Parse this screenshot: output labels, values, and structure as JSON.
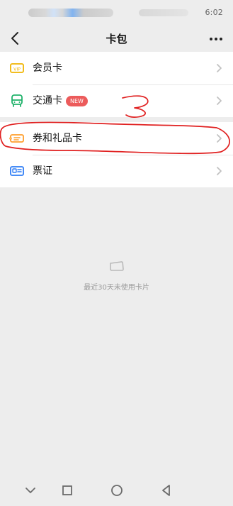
{
  "status_bar": {
    "time": "6:02"
  },
  "header": {
    "title": "卡包"
  },
  "menu": {
    "items": [
      {
        "label": "会员卡",
        "icon": "vip-icon"
      },
      {
        "label": "交通卡",
        "badge": "NEW",
        "icon": "bus-icon"
      },
      {
        "label": "券和礼品卡",
        "icon": "coupon-icon"
      },
      {
        "label": "票证",
        "icon": "ticket-icon"
      }
    ]
  },
  "empty_state": {
    "text": "最近30天未使用卡片"
  },
  "colors": {
    "background": "#ededed",
    "card": "#ffffff",
    "badge": "#ec5b5b",
    "vip": "#f0b400",
    "bus": "#21b26b",
    "coupon": "#ff9e2c",
    "ticket": "#2f7df5",
    "annotation": "#e02020"
  }
}
